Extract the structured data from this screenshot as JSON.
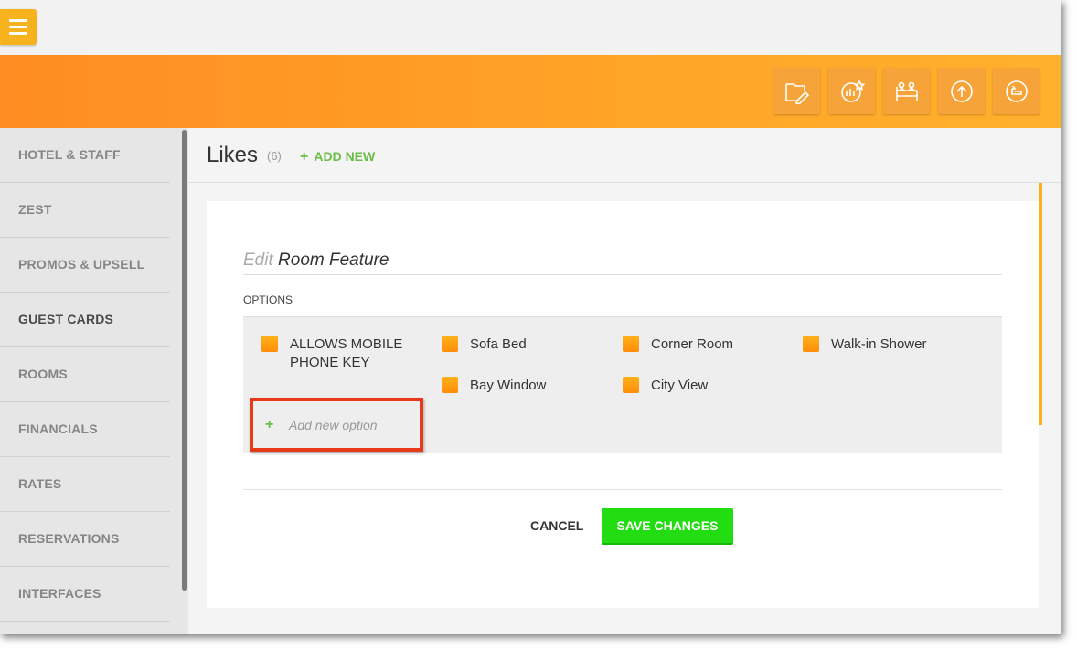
{
  "topbar": {
    "menu_icon": "hamburger-menu-icon"
  },
  "header": {
    "actions": [
      {
        "icon": "folder-edit-icon"
      },
      {
        "icon": "chart-star-icon"
      },
      {
        "icon": "guest-bed-icon"
      },
      {
        "icon": "upload-icon"
      },
      {
        "icon": "logout-icon"
      }
    ],
    "gradient": [
      "#ff8c22",
      "#ffb12c"
    ]
  },
  "sidebar": {
    "items": [
      {
        "label": "HOTEL & STAFF"
      },
      {
        "label": "ZEST"
      },
      {
        "label": "PROMOS & UPSELL"
      },
      {
        "label": "GUEST CARDS"
      },
      {
        "label": "ROOMS"
      },
      {
        "label": "FINANCIALS"
      },
      {
        "label": "RATES"
      },
      {
        "label": "RESERVATIONS"
      },
      {
        "label": "INTERFACES"
      }
    ],
    "active_label": "GUEST CARDS"
  },
  "page": {
    "title": "Likes",
    "count": "(6)",
    "add_new_label": "ADD NEW"
  },
  "form": {
    "edit_prefix": "Edit",
    "edit_subject": "Room Feature",
    "options_heading": "OPTIONS",
    "options": [
      {
        "label": "ALLOWS MOBILE PHONE KEY"
      },
      {
        "label": "Sofa Bed"
      },
      {
        "label": "Corner Room"
      },
      {
        "label": "Walk-in Shower"
      },
      {
        "label": "Bay Window"
      },
      {
        "label": "City View"
      }
    ],
    "add_option_placeholder": "Add new option",
    "cancel_label": "CANCEL",
    "save_label": "SAVE CHANGES"
  },
  "colors": {
    "accent": "#f7b31e",
    "add_green": "#6abd45",
    "save_green": "#22dd11",
    "highlight_red": "#e63a1b"
  }
}
